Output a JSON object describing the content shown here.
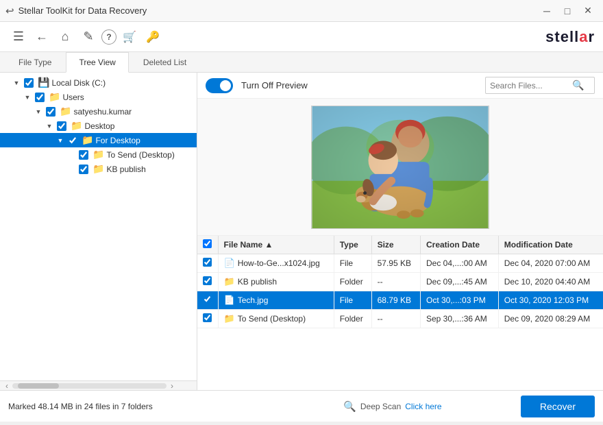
{
  "titleBar": {
    "title": "Stellar ToolKit for Data Recovery",
    "backIcon": "↩",
    "minBtn": "─",
    "maxBtn": "□",
    "closeBtn": "✕"
  },
  "toolbar": {
    "menuIcon": "☰",
    "backIcon": "←",
    "homeIcon": "⌂",
    "settingsIcon": "✎",
    "helpIcon": "?",
    "cartIcon": "🛒",
    "keyIcon": "🔑",
    "logoText": "stell",
    "logoAccent": "a",
    "logoRest": "r"
  },
  "tabs": [
    {
      "label": "File Type",
      "active": false
    },
    {
      "label": "Tree View",
      "active": true
    },
    {
      "label": "Deleted List",
      "active": false
    }
  ],
  "treeView": {
    "items": [
      {
        "id": "local-disk",
        "level": 0,
        "expanded": true,
        "checked": true,
        "label": "Local Disk (C:)",
        "type": "drive"
      },
      {
        "id": "users",
        "level": 1,
        "expanded": true,
        "checked": true,
        "label": "Users",
        "type": "folder"
      },
      {
        "id": "satyeshu",
        "level": 2,
        "expanded": true,
        "checked": true,
        "label": "satyeshu.kumar",
        "type": "folder"
      },
      {
        "id": "desktop",
        "level": 3,
        "expanded": true,
        "checked": true,
        "label": "Desktop",
        "type": "folder"
      },
      {
        "id": "fordesktop",
        "level": 4,
        "expanded": true,
        "checked": true,
        "label": "For Desktop",
        "type": "folder",
        "selected": true
      },
      {
        "id": "tosend",
        "level": 5,
        "expanded": false,
        "checked": true,
        "label": "To Send (Desktop)",
        "type": "folder"
      },
      {
        "id": "kbpublish",
        "level": 5,
        "expanded": false,
        "checked": true,
        "label": "KB publish",
        "type": "folder"
      }
    ]
  },
  "preview": {
    "toggleLabel": "Turn Off Preview",
    "searchPlaceholder": "Search Files..."
  },
  "fileTable": {
    "columns": [
      "",
      "File Name",
      "Type",
      "Size",
      "Creation Date",
      "Modification Date"
    ],
    "rows": [
      {
        "checked": true,
        "fileName": "How-to-Ge...x1024.jpg",
        "fileType": "File",
        "size": "57.95 KB",
        "creationDate": "Dec 04,...:00 AM",
        "modDate": "Dec 04, 2020 07:00 AM",
        "icon": "file",
        "selected": false
      },
      {
        "checked": true,
        "fileName": "KB publish",
        "fileType": "Folder",
        "size": "--",
        "creationDate": "Dec 09,...:45 AM",
        "modDate": "Dec 10, 2020 04:40 AM",
        "icon": "folder",
        "selected": false
      },
      {
        "checked": true,
        "fileName": "Tech.jpg",
        "fileType": "File",
        "size": "68.79 KB",
        "creationDate": "Oct 30,...:03 PM",
        "modDate": "Oct 30, 2020 12:03 PM",
        "icon": "file",
        "selected": true
      },
      {
        "checked": true,
        "fileName": "To Send (Desktop)",
        "fileType": "Folder",
        "size": "--",
        "creationDate": "Sep 30,...:36 AM",
        "modDate": "Dec 09, 2020 08:29 AM",
        "icon": "folder",
        "selected": false
      }
    ]
  },
  "statusBar": {
    "markedText": "Marked 48.14 MB in 24 files in 7 folders",
    "deepScanText": "Deep Scan",
    "deepScanLink": "Click here",
    "recoverBtn": "Recover"
  }
}
